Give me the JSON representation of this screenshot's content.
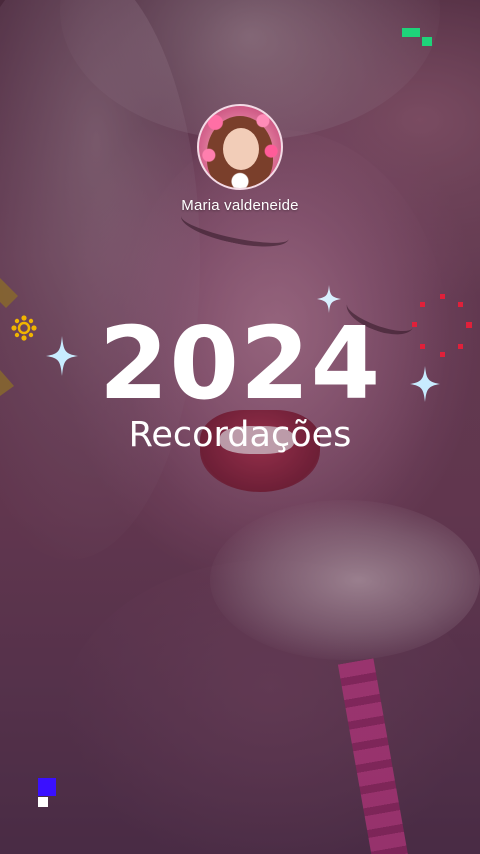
{
  "profile": {
    "name": "Maria valdeneide"
  },
  "headline": {
    "year": "2024",
    "subtitle": "Recordações"
  },
  "colors": {
    "text": "#ffffff",
    "sparkle": "#bfe6ff",
    "firework": "#e0203a",
    "flower": "#f0b400",
    "pixel_green": "#1ed37a",
    "pixel_purple": "#3a10ff"
  },
  "icons": {
    "top_right": "pixel-blocks-green-icon",
    "bottom_left": "pixel-blocks-purple-icon",
    "sparkles": "four-point-star-icon",
    "left_decoration": "flower-icon",
    "right_decoration": "firework-icon"
  }
}
